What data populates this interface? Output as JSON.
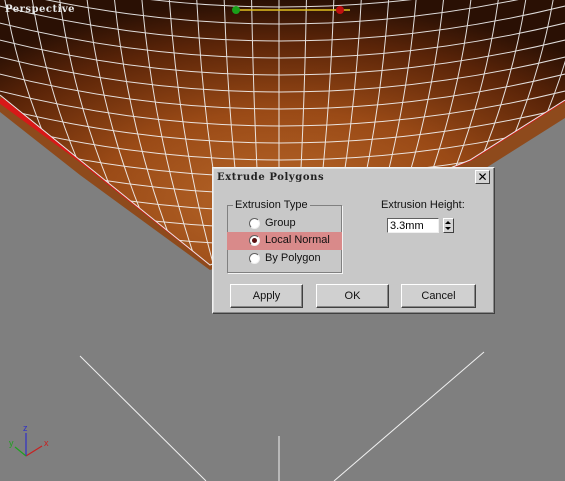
{
  "viewport": {
    "label": "Perspective",
    "axis": {
      "x": "x",
      "y": "y",
      "z": "z"
    },
    "colors": {
      "background": "#7f7f7f",
      "surface": "#a85820",
      "surface_dark": "#2a1004",
      "wire": "#ffffff",
      "edge_selection": "#cc1010"
    }
  },
  "dialog": {
    "title": "Extrude Polygons",
    "close_icon": "close-icon",
    "extrusion_type": {
      "legend": "Extrusion Type",
      "options": [
        {
          "label": "Group",
          "selected": false
        },
        {
          "label": "Local Normal",
          "selected": true
        },
        {
          "label": "By Polygon",
          "selected": false
        }
      ]
    },
    "extrusion_height": {
      "label": "Extrusion Height:",
      "value": "3.3mm"
    },
    "buttons": {
      "apply": "Apply",
      "ok": "OK",
      "cancel": "Cancel"
    }
  }
}
